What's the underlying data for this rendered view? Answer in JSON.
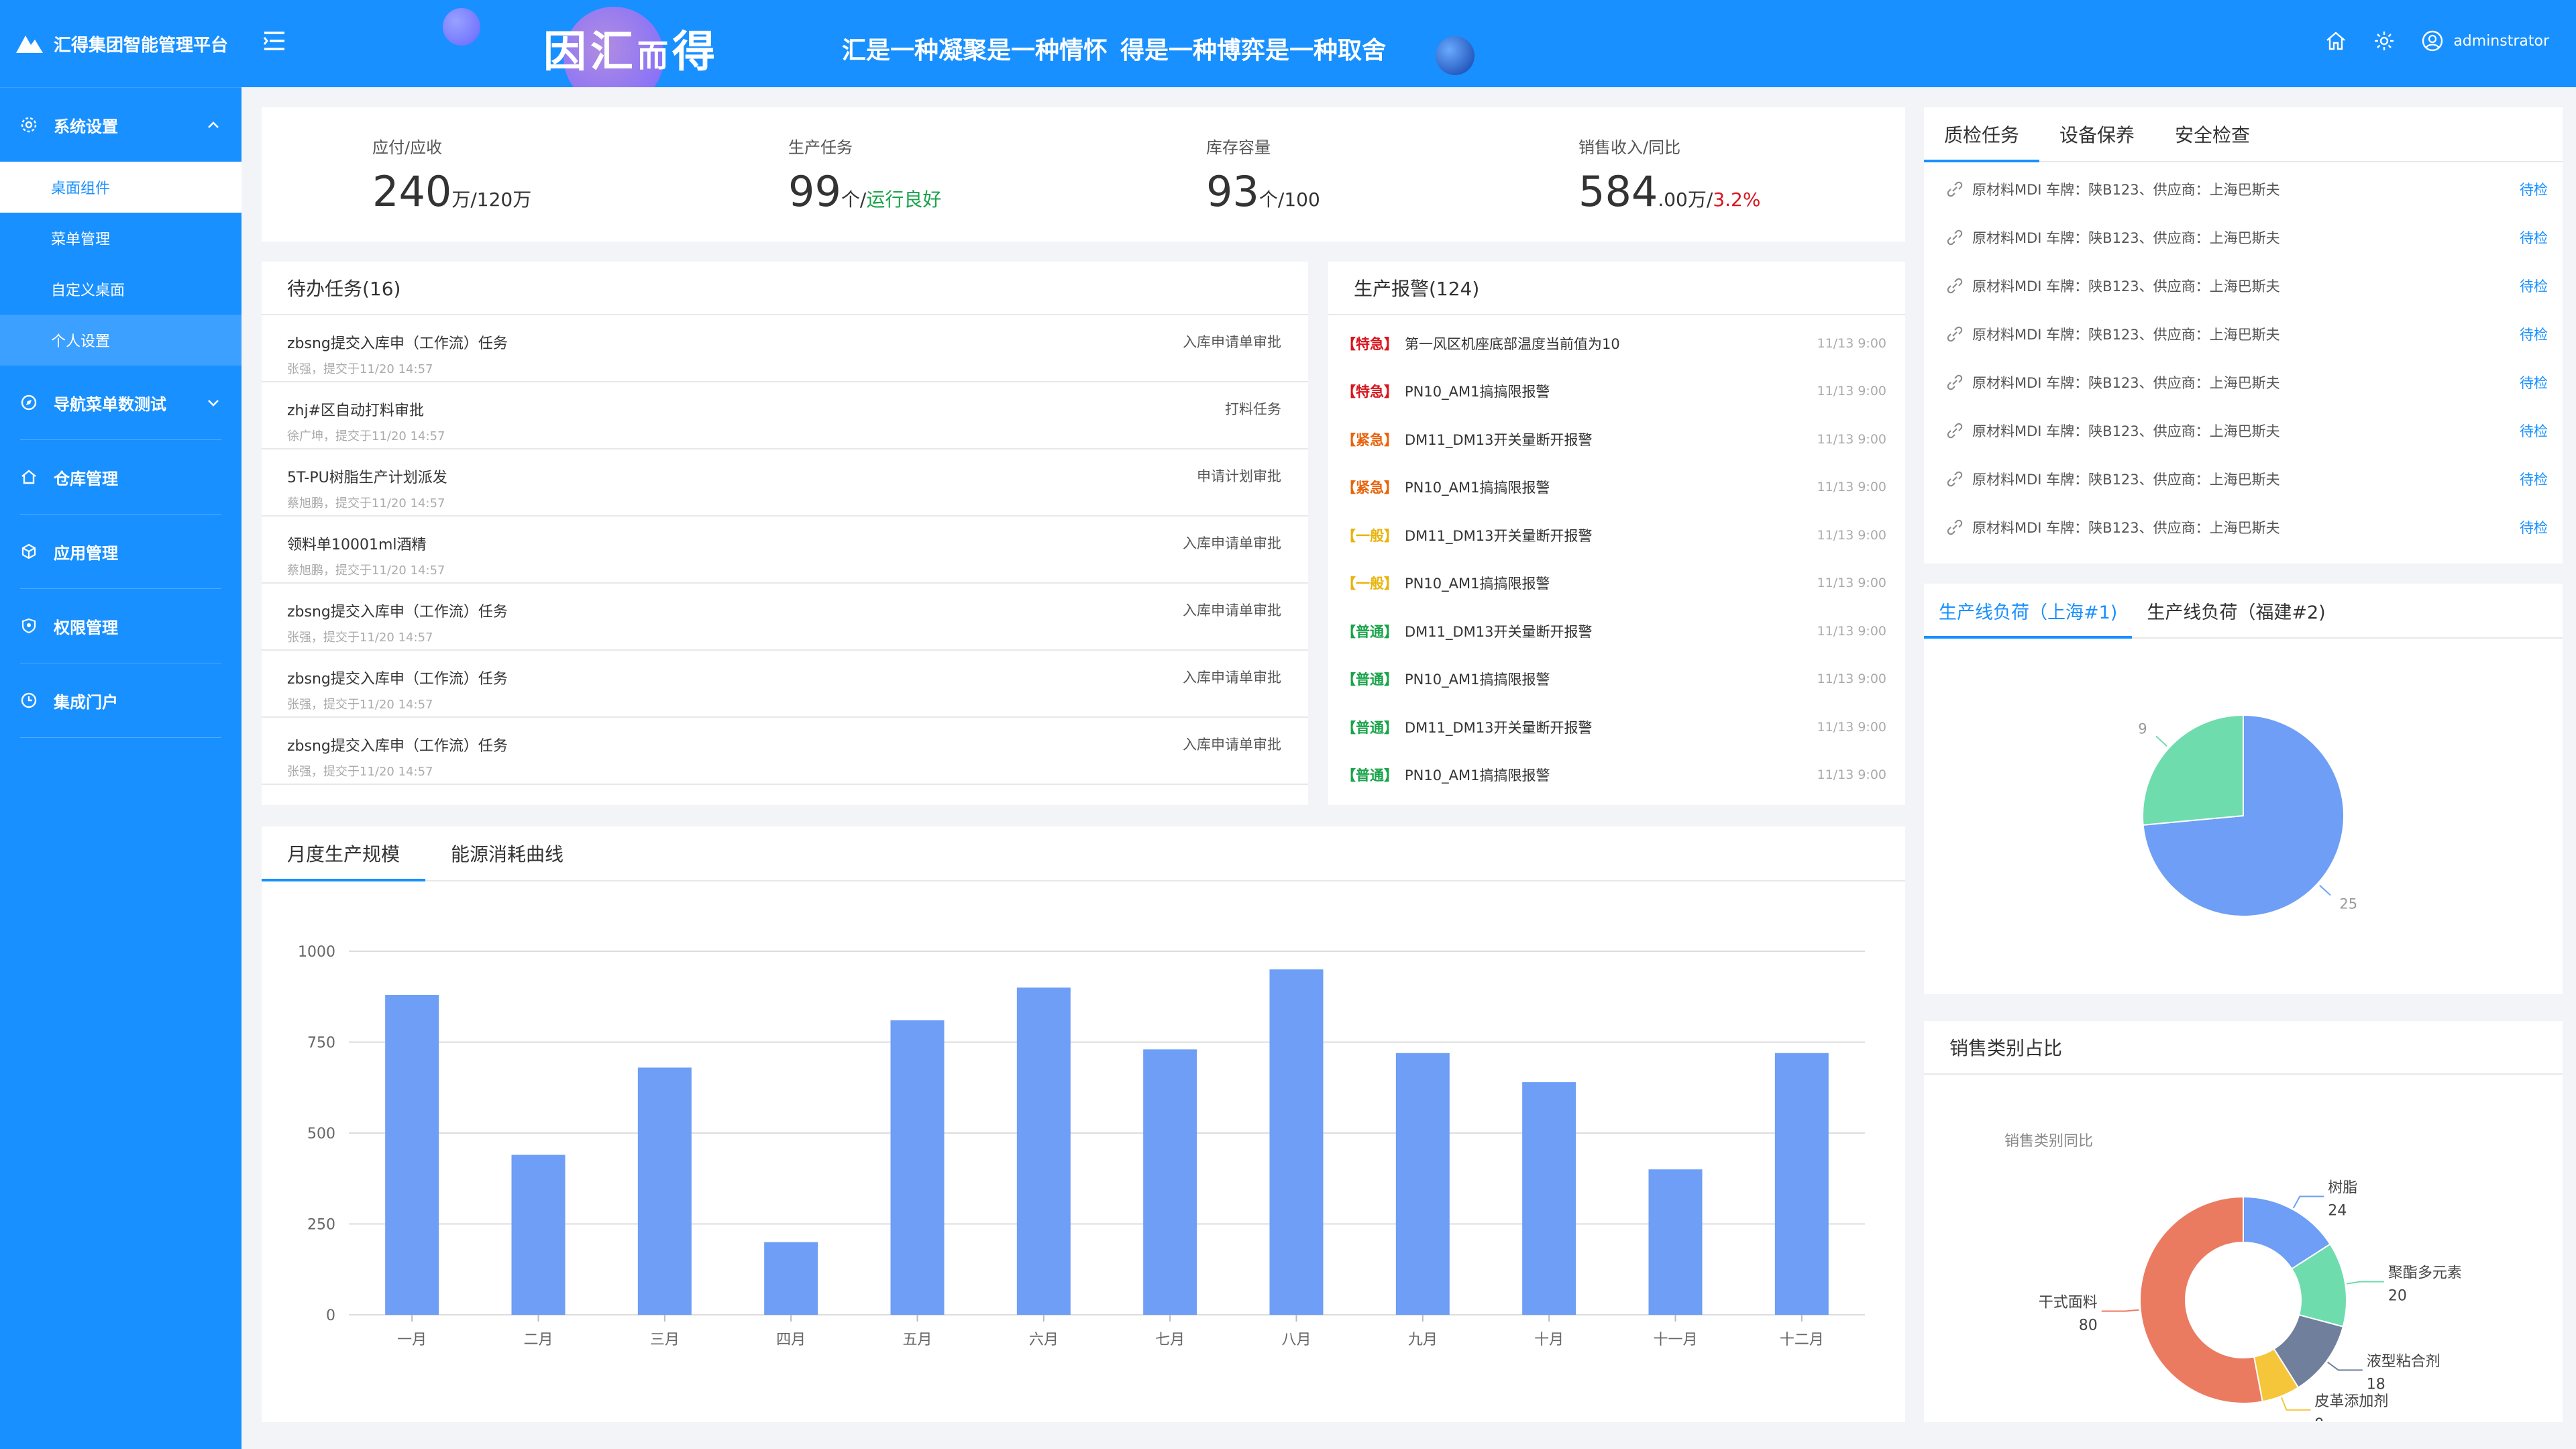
{
  "brand": {
    "title": "汇得集团智能管理平台"
  },
  "sidebar": {
    "groups": [
      {
        "label": "系统设置",
        "icon": "gear-icon",
        "expanded": true,
        "items": [
          "桌面组件",
          "菜单管理",
          "自定义桌面",
          "个人设置"
        ]
      },
      {
        "label": "导航菜单数测试",
        "icon": "compass-icon",
        "expanded": false
      },
      {
        "label": "仓库管理",
        "icon": "home-icon"
      },
      {
        "label": "应用管理",
        "icon": "cube-icon"
      },
      {
        "label": "权限管理",
        "icon": "shield-icon"
      },
      {
        "label": "集成门户",
        "icon": "clock-icon"
      }
    ]
  },
  "header": {
    "slogan_big_1": "因汇",
    "slogan_big_2": "而",
    "slogan_big_3": "得",
    "slogan_1": "汇是一种凝聚是一种情怀",
    "slogan_2": "得是一种博弈是一种取舍",
    "username": "adminstrator"
  },
  "kpis": [
    {
      "label": "应付/应收",
      "value": "240",
      "unit": "万/120万"
    },
    {
      "label": "生产任务",
      "value": "99",
      "unit": "个/",
      "status": "运行良好"
    },
    {
      "label": "库存容量",
      "value": "93",
      "unit": "个/100"
    },
    {
      "label": "销售收入/同比",
      "value": "584",
      "unit": ".00万/",
      "ratio": "3.2%"
    }
  ],
  "todo": {
    "title": "待办任务(16)",
    "items": [
      {
        "title": "zbsng提交入库申（工作流）任务",
        "meta": "张强，提交于11/20  14:57",
        "tag": "入库申请单审批"
      },
      {
        "title": "zhj#区自动打料审批",
        "meta": "徐广坤，提交于11/20  14:57",
        "tag": "打料任务"
      },
      {
        "title": "5T-PU树脂生产计划派发",
        "meta": "蔡旭鹏，提交于11/20  14:57",
        "tag": "申请计划审批"
      },
      {
        "title": "领料单10001ml酒精",
        "meta": "蔡旭鹏，提交于11/20  14:57",
        "tag": "入库申请单审批"
      },
      {
        "title": "zbsng提交入库申（工作流）任务",
        "meta": "张强，提交于11/20  14:57",
        "tag": "入库申请单审批"
      },
      {
        "title": "zbsng提交入库申（工作流）任务",
        "meta": "张强，提交于11/20  14:57",
        "tag": "入库申请单审批"
      },
      {
        "title": "zbsng提交入库申（工作流）任务",
        "meta": "张强，提交于11/20  14:57",
        "tag": "入库申请单审批"
      }
    ]
  },
  "alarms": {
    "title": "生产报警(124)",
    "items": [
      {
        "level": "【特急】",
        "color": "#d9151e",
        "msg": "第一风区机座底部温度当前值为10",
        "time": "11/13 9:00"
      },
      {
        "level": "【特急】",
        "color": "#d9151e",
        "msg": "PN10_AM1搞搞限报警",
        "time": "11/13 9:00"
      },
      {
        "level": "【紧急】",
        "color": "#e8640c",
        "msg": "DM11_DM13开关量断开报警",
        "time": "11/13 9:00"
      },
      {
        "level": "【紧急】",
        "color": "#e8640c",
        "msg": "PN10_AM1搞搞限报警",
        "time": "11/13 9:00"
      },
      {
        "level": "【一般】",
        "color": "#e8b40c",
        "msg": "DM11_DM13开关量断开报警",
        "time": "11/13 9:00"
      },
      {
        "level": "【一般】",
        "color": "#e8b40c",
        "msg": "PN10_AM1搞搞限报警",
        "time": "11/13 9:00"
      },
      {
        "level": "【普通】",
        "color": "#1aa34a",
        "msg": "DM11_DM13开关量断开报警",
        "time": "11/13 9:00"
      },
      {
        "level": "【普通】",
        "color": "#1aa34a",
        "msg": "PN10_AM1搞搞限报警",
        "time": "11/13 9:00"
      },
      {
        "level": "【普通】",
        "color": "#1aa34a",
        "msg": "DM11_DM13开关量断开报警",
        "time": "11/13 9:00"
      },
      {
        "level": "【普通】",
        "color": "#1aa34a",
        "msg": "PN10_AM1搞搞限报警",
        "time": "11/13 9:00"
      }
    ]
  },
  "production_tabs": [
    "月度生产规模",
    "能源消耗曲线"
  ],
  "qc": {
    "tabs": [
      "质检任务",
      "设备保养",
      "安全检查"
    ],
    "items": [
      {
        "text": "原材料MDI  车牌：陕B123、供应商：上海巴斯夫",
        "status": "待检"
      },
      {
        "text": "原材料MDI  车牌：陕B123、供应商：上海巴斯夫",
        "status": "待检"
      },
      {
        "text": "原材料MDI  车牌：陕B123、供应商：上海巴斯夫",
        "status": "待检"
      },
      {
        "text": "原材料MDI  车牌：陕B123、供应商：上海巴斯夫",
        "status": "待检"
      },
      {
        "text": "原材料MDI  车牌：陕B123、供应商：上海巴斯夫",
        "status": "待检"
      },
      {
        "text": "原材料MDI  车牌：陕B123、供应商：上海巴斯夫",
        "status": "待检"
      },
      {
        "text": "原材料MDI  车牌：陕B123、供应商：上海巴斯夫",
        "status": "待检"
      },
      {
        "text": "原材料MDI  车牌：陕B123、供应商：上海巴斯夫",
        "status": "待检"
      }
    ]
  },
  "load_tabs": [
    "生产线负荷（上海#1)",
    "生产线负荷（福建#2)"
  ],
  "sales_title": "销售类别占比",
  "colors": {
    "primary": "#1890ff",
    "bar": "#6e9ef5",
    "pie_blue": "#6e9ef5",
    "pie_green": "#6fdcae"
  },
  "chart_data": [
    {
      "type": "bar",
      "categories": [
        "一月",
        "二月",
        "三月",
        "四月",
        "五月",
        "六月",
        "七月",
        "八月",
        "九月",
        "十月",
        "十一月",
        "十二月"
      ],
      "values": [
        880,
        440,
        680,
        200,
        810,
        900,
        730,
        950,
        720,
        640,
        400,
        720
      ],
      "ylim": [
        0,
        1000
      ],
      "yticks": [
        0,
        250,
        500,
        750,
        1000
      ],
      "grid": true
    },
    {
      "type": "pie",
      "labels": [
        "",
        ""
      ],
      "values": [
        25,
        9
      ],
      "colors": [
        "#6e9ef5",
        "#6fdcae"
      ]
    },
    {
      "type": "pie",
      "title": "销售类别同比",
      "donut": true,
      "labels": [
        "树脂",
        "聚酯多元素",
        "液型粘合剂",
        "皮革添加剂",
        "干式面料"
      ],
      "values": [
        24,
        20,
        18,
        9,
        80
      ],
      "colors": [
        "#6e9ef5",
        "#6fdcae",
        "#6f7f9c",
        "#f5c63a",
        "#eb7b60"
      ]
    }
  ]
}
